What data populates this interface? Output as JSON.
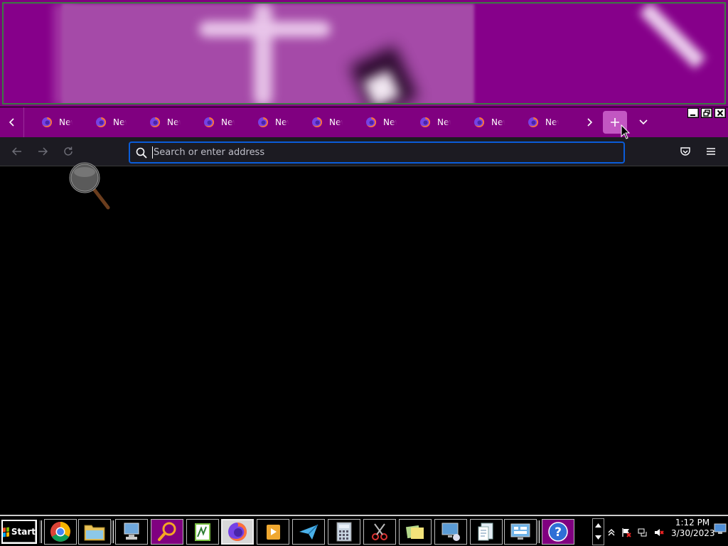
{
  "browser": {
    "tabs": [
      {
        "label": "New Tab",
        "icon": "firefox-icon"
      },
      {
        "label": "New Tab",
        "icon": "firefox-icon"
      },
      {
        "label": "New Tab",
        "icon": "firefox-icon"
      },
      {
        "label": "New Tab",
        "icon": "firefox-icon"
      },
      {
        "label": "New Tab",
        "icon": "firefox-icon"
      },
      {
        "label": "New Tab",
        "icon": "firefox-icon"
      },
      {
        "label": "New Tab",
        "icon": "firefox-icon"
      },
      {
        "label": "New Tab",
        "icon": "firefox-icon"
      },
      {
        "label": "New Tab",
        "icon": "firefox-icon"
      },
      {
        "label": "New Tab",
        "icon": "firefox-icon"
      }
    ],
    "urlbar": {
      "placeholder": "Search or enter address",
      "value": ""
    },
    "colors": {
      "tabbar_bg": "#800080",
      "newtab_hover": "#c257c2",
      "navbar_bg": "#1c1b22",
      "urlbar_focus": "#0a5cd9"
    }
  },
  "taskbar": {
    "start_label": "Start",
    "apps": [
      "chrome-icon",
      "file-explorer-icon",
      "computer-network-icon",
      "magnifier-search-icon",
      "spreadsheet-editor-icon",
      "firefox-icon",
      "media-player-icon",
      "send-mail-icon",
      "calculator-icon",
      "snipping-tool-icon",
      "sticky-notes-icon",
      "remote-desktop-icon",
      "document-viewer-icon",
      "control-panel-icon",
      "help-icon"
    ],
    "clock": {
      "time": "1:12 PM",
      "date": "3/30/2023"
    }
  }
}
